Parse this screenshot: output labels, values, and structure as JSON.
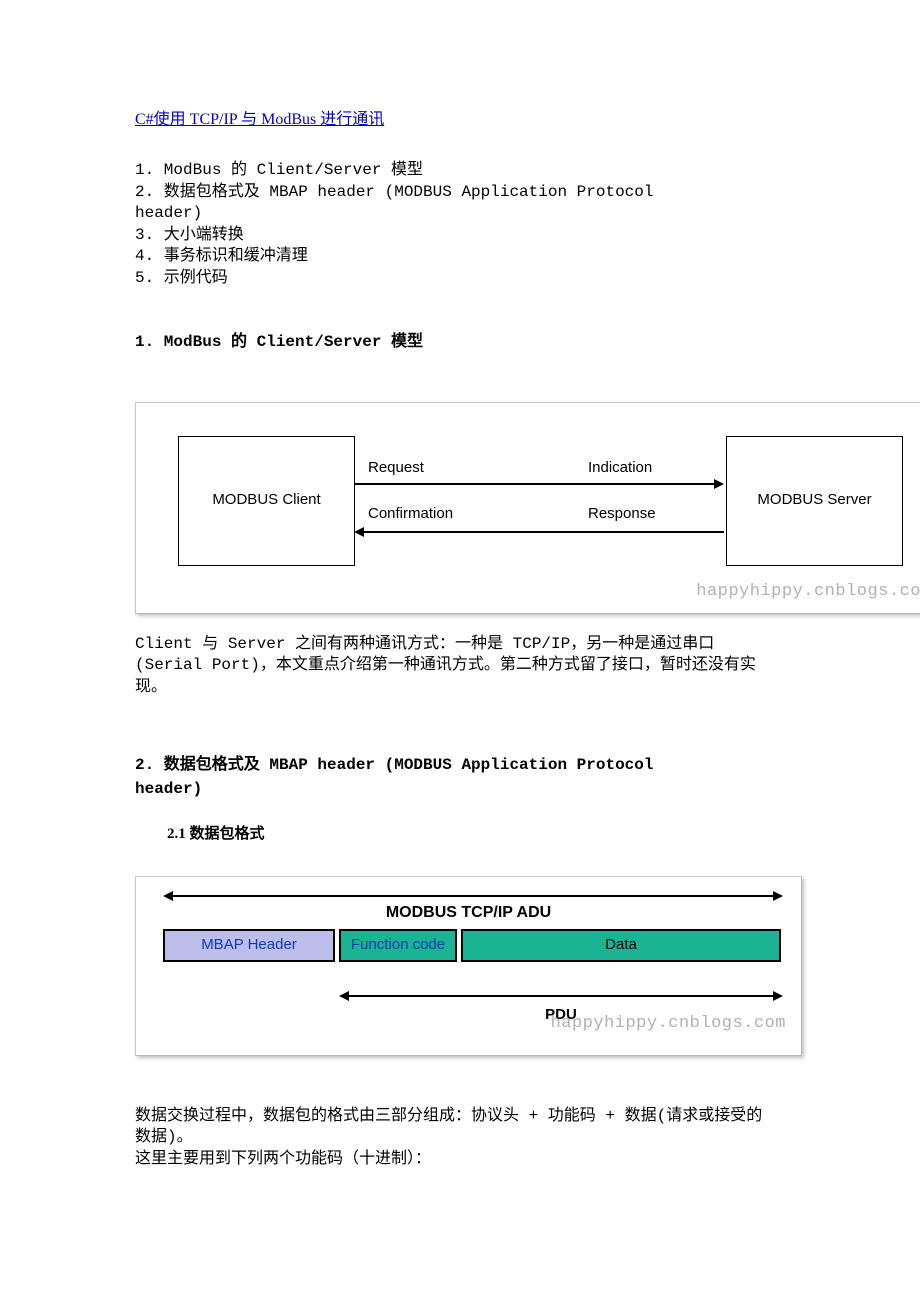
{
  "title": "C#使用 TCP/IP 与 ModBus 进行通讯",
  "toc": [
    "1.  ModBus 的 Client/Server 模型",
    "2.  数据包格式及 MBAP header (MODBUS Application Protocol header)",
    "3.  大小端转换",
    "4.  事务标识和缓冲清理",
    "5.  示例代码"
  ],
  "section1": {
    "heading": "1.  ModBus 的 Client/Server 模型",
    "diagram": {
      "client": "MODBUS Client",
      "server": "MODBUS Server",
      "request": "Request",
      "indication": "Indication",
      "confirmation": "Confirmation",
      "response": "Response",
      "watermark": "happyhippy.cnblogs.co"
    },
    "para": "    Client 与 Server 之间有两种通讯方式：一种是 TCP/IP，另一种是通过串口(Serial Port)，本文重点介绍第一种通讯方式。第二种方式留了接口，暂时还没有实现。"
  },
  "section2": {
    "heading": "2.  数据包格式及 MBAP header (MODBUS Application Protocol header)",
    "sub": "2.1 数据包格式",
    "diagram": {
      "adu": "MODBUS TCP/IP ADU",
      "mbap": "MBAP Header",
      "fc": "Function code",
      "data": "Data",
      "pdu": "PDU",
      "watermark": "happyhippy.cnblogs.com"
    },
    "para1": "    数据交换过程中，数据包的格式由三部分组成：协议头 + 功能码 + 数据(请求或接受的数据)。",
    "para2": "    这里主要用到下列两个功能码（十进制）："
  }
}
